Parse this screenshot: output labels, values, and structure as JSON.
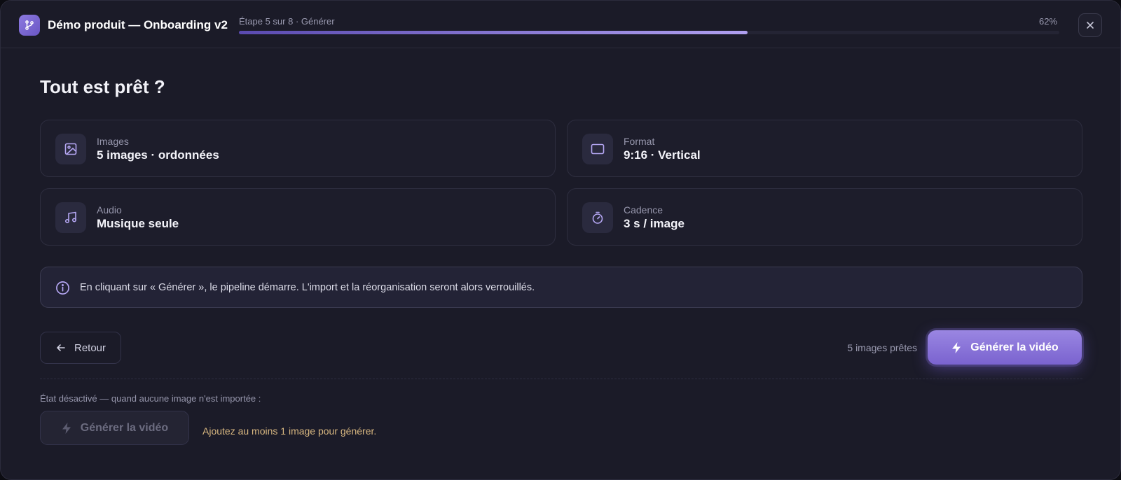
{
  "header": {
    "app_title": "Démo produit — Onboarding v2",
    "step_label": "Étape 5 sur 8 · Générer",
    "progress_label": "62%",
    "progress": 0.62
  },
  "main": {
    "title": "Tout est prêt ?",
    "cards": [
      {
        "label": "Images",
        "value": "5 images · ordonnées",
        "icon": "image-icon"
      },
      {
        "label": "Format",
        "value": "9:16 · Vertical",
        "icon": "frame-icon"
      },
      {
        "label": "Audio",
        "value": "Musique seule",
        "icon": "music-icon"
      },
      {
        "label": "Cadence",
        "value": "3 s / image",
        "icon": "timer-icon"
      }
    ],
    "info_text": "En cliquant sur « Générer », le pipeline démarre. L'import et la réorganisation seront alors verrouillés."
  },
  "footer": {
    "back_label": "Retour",
    "ready_count": "5 images prêtes",
    "generate_label": "Générer la vidéo"
  },
  "disabled_state": {
    "caption": "État désactivé — quand aucune image n'est importée :",
    "generate_label": "Générer la vidéo",
    "hint": "Ajoutez au moins 1 image pour générer."
  },
  "colors": {
    "accent": "#8b76dc",
    "background": "#1b1b28",
    "warning_text": "#d8b780"
  }
}
